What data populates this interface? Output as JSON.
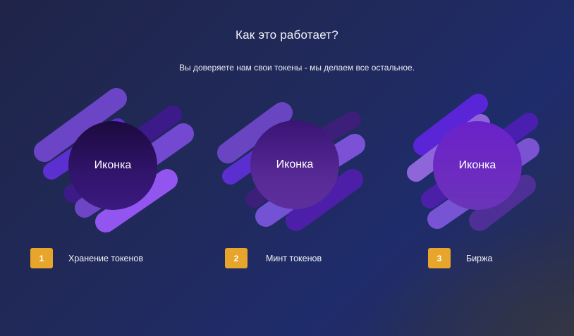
{
  "header": {
    "title": "Как это работает?",
    "subtitle": "Вы доверяете нам свои токены - мы делаем все остальное."
  },
  "steps": [
    {
      "number": "1",
      "label": "Хранение токенов",
      "icon_text": "Иконка"
    },
    {
      "number": "2",
      "label": "Минт токенов",
      "icon_text": "Иконка"
    },
    {
      "number": "3",
      "label": "Биржа",
      "icon_text": "Иконка"
    }
  ],
  "colors": {
    "badge": "#e8a52b",
    "background_start": "#1f2448",
    "background_end": "#1f2c6c",
    "accent_purple": "#7b3fe4"
  },
  "icons": [
    "abstract-purple-stripes-icon",
    "abstract-purple-stripes-icon",
    "abstract-purple-stripes-icon"
  ]
}
